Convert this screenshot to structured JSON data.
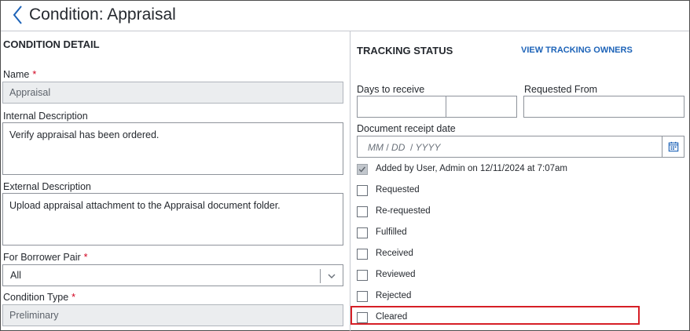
{
  "header": {
    "title": "Condition: Appraisal"
  },
  "condition_detail": {
    "heading": "CONDITION DETAIL",
    "name": {
      "label": "Name",
      "required": "*",
      "value": "Appraisal"
    },
    "internal_description": {
      "label": "Internal Description",
      "value": "Verify appraisal has been ordered."
    },
    "external_description": {
      "label": "External Description",
      "value": "Upload appraisal attachment to the Appraisal document folder."
    },
    "borrower_pair": {
      "label": "For Borrower Pair",
      "required": "*",
      "value": "All"
    },
    "condition_type": {
      "label": "Condition Type",
      "required": "*",
      "value": "Preliminary"
    }
  },
  "tracking": {
    "heading": "TRACKING STATUS",
    "view_owners_link": "VIEW TRACKING OWNERS",
    "days_to_receive_label": "Days to receive",
    "requested_from_label": "Requested From",
    "receipt_date_label": "Document receipt date",
    "date_placeholder": {
      "mm": "MM",
      "dd": "DD",
      "yyyy": "YYYY",
      "sep": "/"
    },
    "items": [
      {
        "label": "Added by User, Admin on 12/11/2024 at 7:07am",
        "checked": true
      },
      {
        "label": "Requested",
        "checked": false
      },
      {
        "label": "Re-requested",
        "checked": false
      },
      {
        "label": "Fulfilled",
        "checked": false
      },
      {
        "label": "Received",
        "checked": false
      },
      {
        "label": "Reviewed",
        "checked": false
      },
      {
        "label": "Rejected",
        "checked": false
      },
      {
        "label": "Cleared",
        "checked": false
      }
    ]
  },
  "colors": {
    "accent_link": "#1d63b8",
    "required": "#d1021f",
    "highlight": "#d61f26"
  }
}
